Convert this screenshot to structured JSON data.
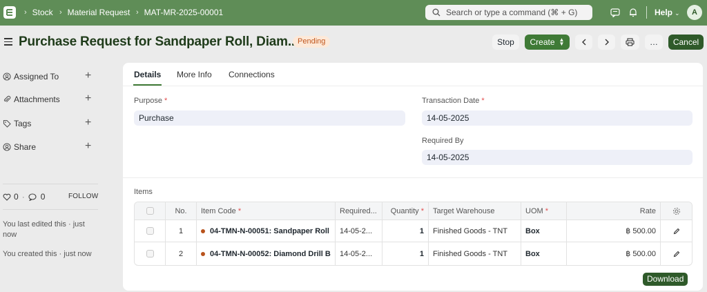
{
  "navbar": {
    "breadcrumbs": [
      "Stock",
      "Material Request",
      "MAT-MR-2025-00001"
    ],
    "search_placeholder": "Search or type a command (⌘ + G)",
    "help_label": "Help",
    "avatar_initial": "A"
  },
  "page": {
    "title": "Purchase Request for Sandpaper Roll, Diam...",
    "status": "Pending",
    "buttons": {
      "stop": "Stop",
      "create": "Create",
      "cancel": "Cancel",
      "more": "…"
    }
  },
  "sidebar": {
    "items": [
      {
        "label": "Assigned To",
        "icon": "assign-icon"
      },
      {
        "label": "Attachments",
        "icon": "paperclip-icon"
      },
      {
        "label": "Tags",
        "icon": "tag-icon"
      },
      {
        "label": "Share",
        "icon": "share-icon"
      }
    ],
    "likes": "0",
    "comments": "0",
    "separator": "·",
    "follow_label": "FOLLOW",
    "edited_note": "You last edited this · just now",
    "created_note": "You created this · just now"
  },
  "tabs": [
    "Details",
    "More Info",
    "Connections"
  ],
  "form": {
    "purpose_label": "Purpose",
    "purpose_value": "Purchase",
    "transaction_date_label": "Transaction Date",
    "transaction_date_value": "14-05-2025",
    "required_by_label": "Required By",
    "required_by_value": "14-05-2025",
    "required_marker": "*"
  },
  "items": {
    "section_label": "Items",
    "columns": {
      "no": "No.",
      "item_code": "Item Code",
      "required_by": "Required...",
      "quantity": "Quantity",
      "target_warehouse": "Target Warehouse",
      "uom": "UOM",
      "rate": "Rate"
    },
    "rows": [
      {
        "no": "1",
        "item_code": "04-TMN-N-00051: Sandpaper Roll",
        "required_by": "14-05-2...",
        "quantity": "1",
        "target_warehouse": "Finished Goods - TNT",
        "uom": "Box",
        "rate": "฿ 500.00"
      },
      {
        "no": "2",
        "item_code": "04-TMN-N-00052: Diamond Drill B",
        "required_by": "14-05-2...",
        "quantity": "1",
        "target_warehouse": "Finished Goods - TNT",
        "uom": "Box",
        "rate": "฿ 500.00"
      }
    ],
    "download_label": "Download"
  },
  "colors": {
    "navbar": "#5f8d57",
    "primary": "#3f7a36",
    "status_pending_bg": "#fde9d9",
    "status_pending_text": "#c0561d"
  }
}
